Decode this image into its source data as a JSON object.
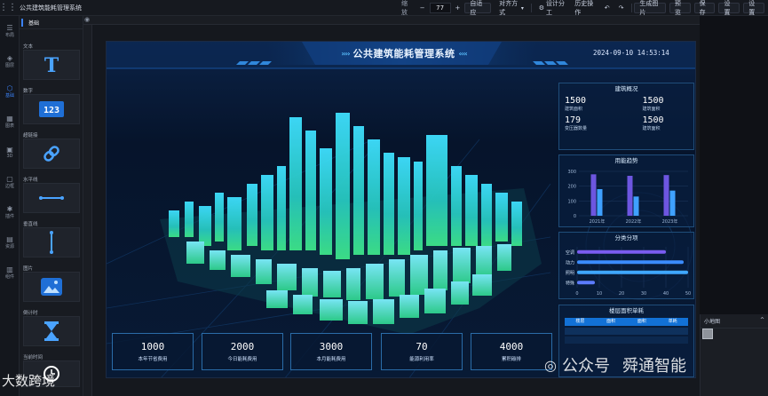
{
  "topbar": {
    "app_title": "公共建筑能耗管理系统",
    "zoom_label": "缩放",
    "zoom_value": "77",
    "zoom_minus": "−",
    "zoom_plus": "+",
    "fit_label": "自适应",
    "align_label": "对齐方式",
    "design_label": "设计分工",
    "history_label": "历史操作",
    "generate_label": "生成图片",
    "preview_label": "预览",
    "save_label": "保存",
    "publish_label": "设置",
    "settings_label": "设置"
  },
  "leftrail": {
    "items": [
      {
        "icon": "layers-icon",
        "label": "布局"
      },
      {
        "icon": "stack-icon",
        "label": "图层"
      },
      {
        "icon": "hexagon-icon",
        "label": "基础"
      },
      {
        "icon": "chart-icon",
        "label": "图表"
      },
      {
        "icon": "cube-icon",
        "label": "3D"
      },
      {
        "icon": "frame-icon",
        "label": "边框"
      },
      {
        "icon": "puzzle-icon",
        "label": "插件"
      },
      {
        "icon": "image-icon",
        "label": "资源"
      },
      {
        "icon": "component-icon",
        "label": "组件"
      }
    ]
  },
  "component_panel": {
    "tab": "基础",
    "items": [
      {
        "label": "文本",
        "glyph": "T"
      },
      {
        "label": "数字",
        "glyph": "123"
      },
      {
        "label": "超链接",
        "glyph": "link"
      },
      {
        "label": "水平线",
        "glyph": "hline"
      },
      {
        "label": "垂直线",
        "glyph": "vline"
      },
      {
        "label": "图片",
        "glyph": "image"
      },
      {
        "label": "倒计时",
        "glyph": "hourglass"
      },
      {
        "label": "当前时间",
        "glyph": "clock"
      }
    ]
  },
  "screen": {
    "title": "公共建筑能耗管理系统",
    "datetime": "2024-09-10  14:53:14",
    "building_overview": {
      "title": "建筑概况",
      "stats": [
        {
          "value": "1500",
          "label": "建筑面积"
        },
        {
          "value": "1500",
          "label": "建筑面积"
        },
        {
          "value": "179",
          "label": "变压器数量"
        },
        {
          "value": "1500",
          "label": "建筑面积"
        }
      ]
    },
    "usage_trend": {
      "title": "用能趋势"
    },
    "category": {
      "title": "分类分项"
    },
    "floor_area": {
      "title": "楼层面积单耗",
      "headers": [
        "楼层",
        "面积",
        "面积",
        "单耗"
      ]
    },
    "kpis": [
      {
        "value": "1000",
        "label": "本年节省费用"
      },
      {
        "value": "2000",
        "label": "今日能耗费用"
      },
      {
        "value": "3000",
        "label": "本月能耗费用"
      },
      {
        "value": "70",
        "label": "能源利用率"
      },
      {
        "value": "4000",
        "label": "累积碳排"
      }
    ]
  },
  "minimap": {
    "title": "小地图",
    "toggle": "^"
  },
  "watermark": {
    "text1": "公众号",
    "text2": "舜通智能",
    "corner": "大数跨境"
  },
  "chart_data": [
    {
      "type": "bar",
      "title": "用能趋势",
      "categories": [
        "2021年",
        "2022年",
        "2023年"
      ],
      "series": [
        {
          "values": [
            280,
            270,
            275
          ],
          "color": "#6d56e0"
        },
        {
          "values": [
            180,
            130,
            170
          ],
          "color": "#3fa1ff"
        }
      ],
      "ylim": [
        0,
        300
      ],
      "yticks": [
        0,
        100,
        200,
        300
      ],
      "grid": true
    },
    {
      "type": "bar",
      "orientation": "horizontal",
      "title": "分类分项",
      "categories": [
        "空调",
        "动力",
        "照明",
        "特殊"
      ],
      "values": [
        40,
        48,
        50,
        8
      ],
      "xlim": [
        0,
        50
      ],
      "xticks": [
        0,
        10,
        20,
        30,
        40,
        50
      ],
      "colors": [
        "#7a5cf0",
        "#3b8cff",
        "#3fa7ff",
        "#5c7cff"
      ]
    }
  ],
  "colors": {
    "accent": "#3b82f6",
    "panel_border": "#1f4d7a",
    "screen_bg": "#0a1a33"
  }
}
